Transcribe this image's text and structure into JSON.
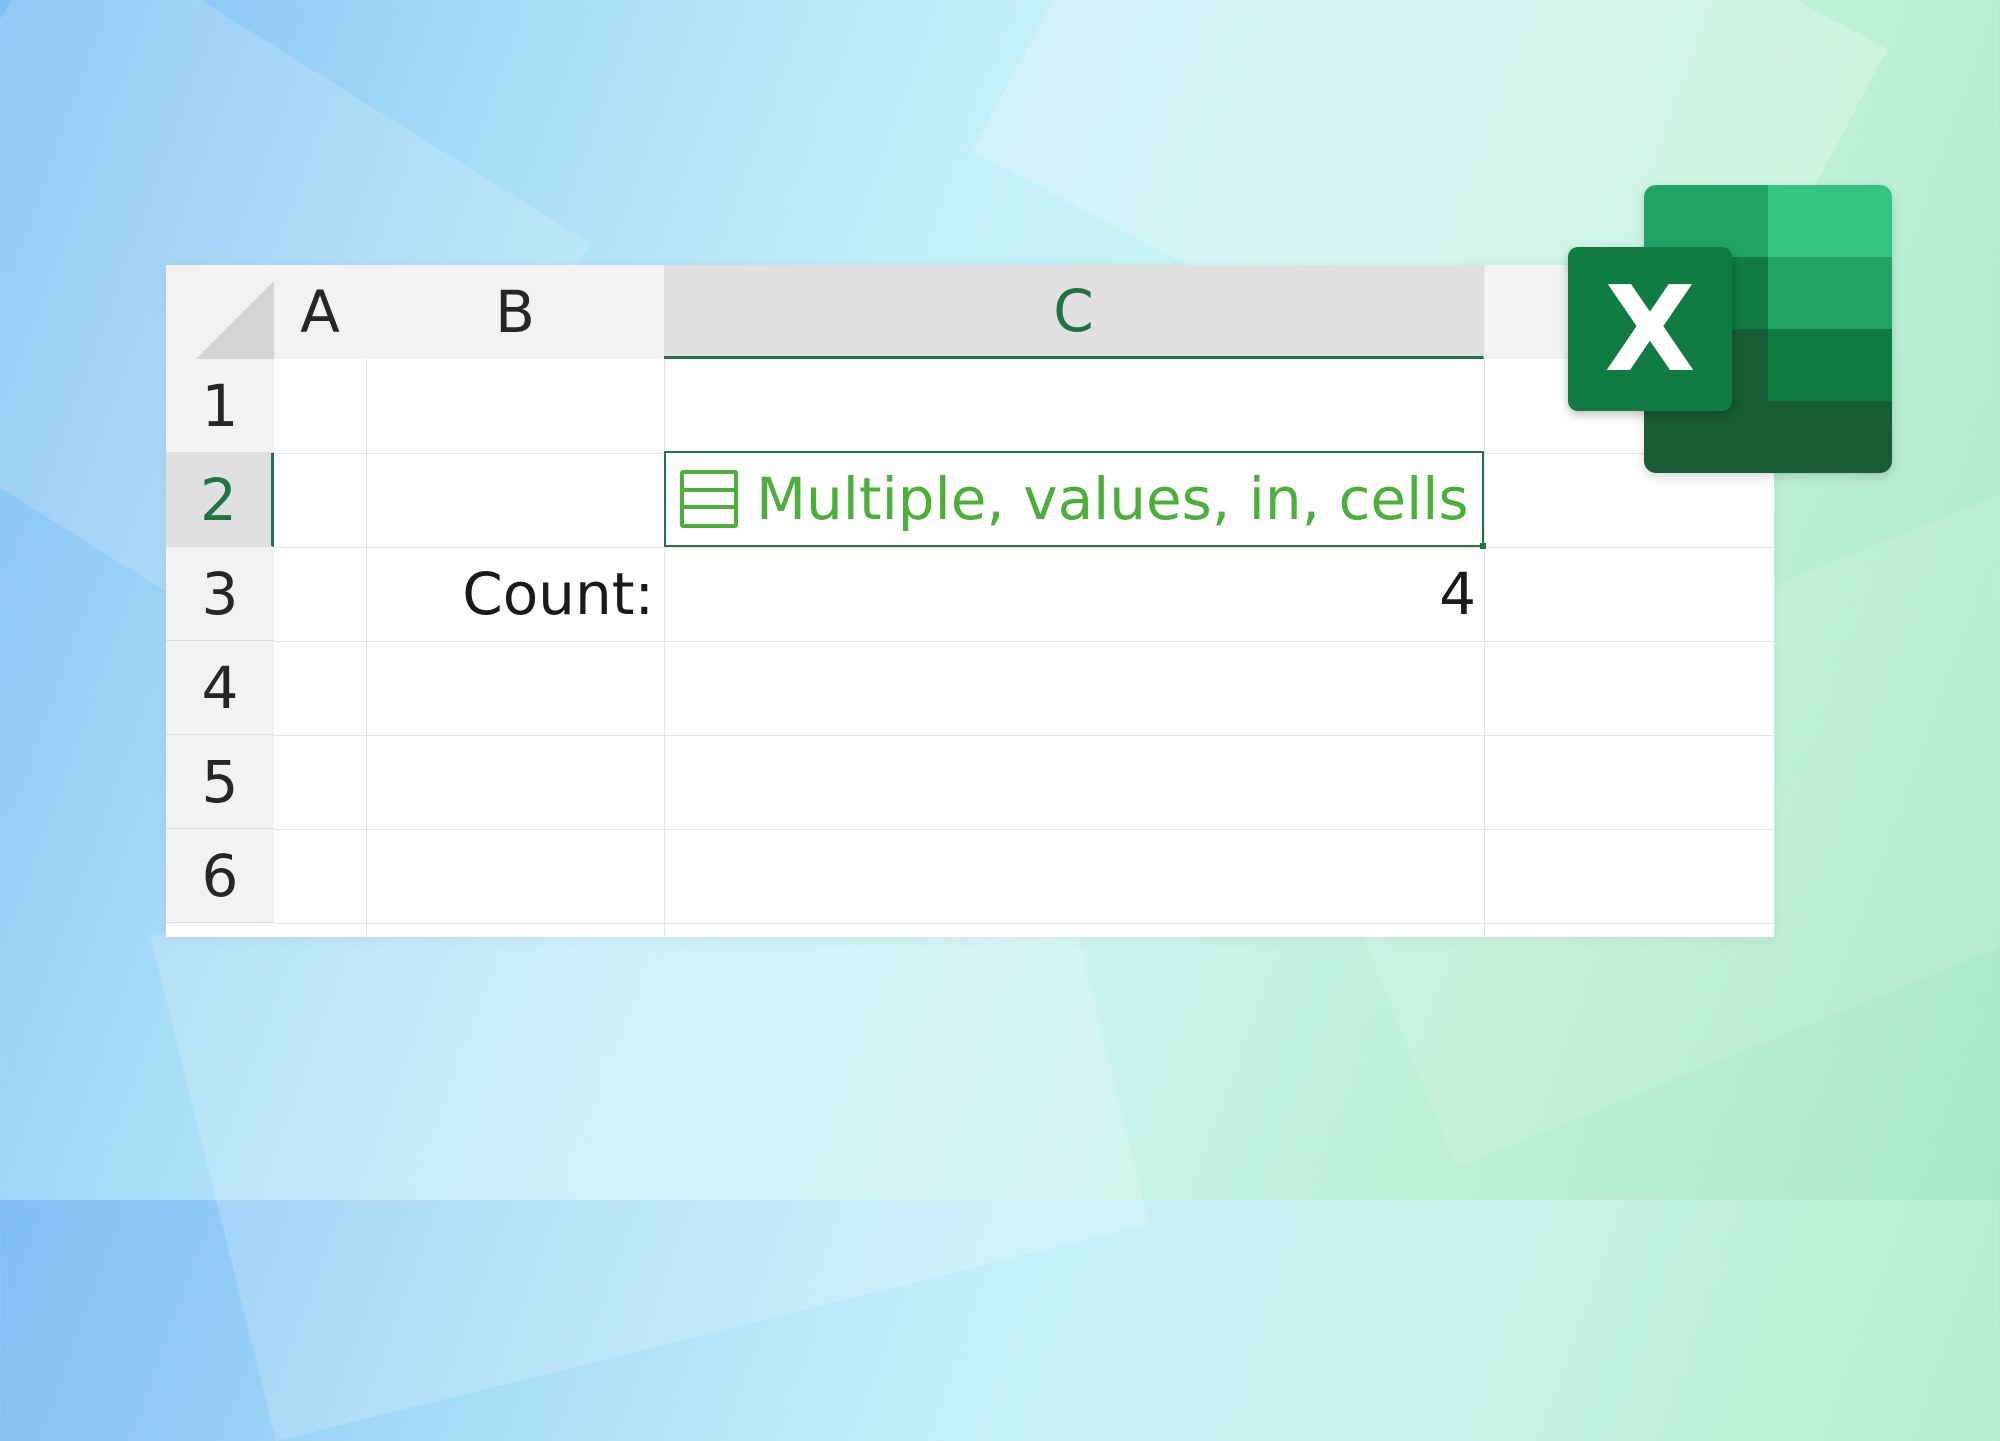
{
  "sheet": {
    "columns": [
      "A",
      "B",
      "C"
    ],
    "rows": [
      "1",
      "2",
      "3",
      "4",
      "5",
      "6"
    ],
    "active_cell": {
      "column": "C",
      "row": "2",
      "value": "Multiple, values, in, cells",
      "icon": "entity-card-icon"
    },
    "cells": {
      "B3": "Count:",
      "C3": "4"
    }
  },
  "app": {
    "logo_letter": "X",
    "logo_icon": "excel-logo-icon"
  },
  "colors": {
    "accent": "#217346",
    "entity": "#4caf3a",
    "logo_green": "#107c41"
  }
}
